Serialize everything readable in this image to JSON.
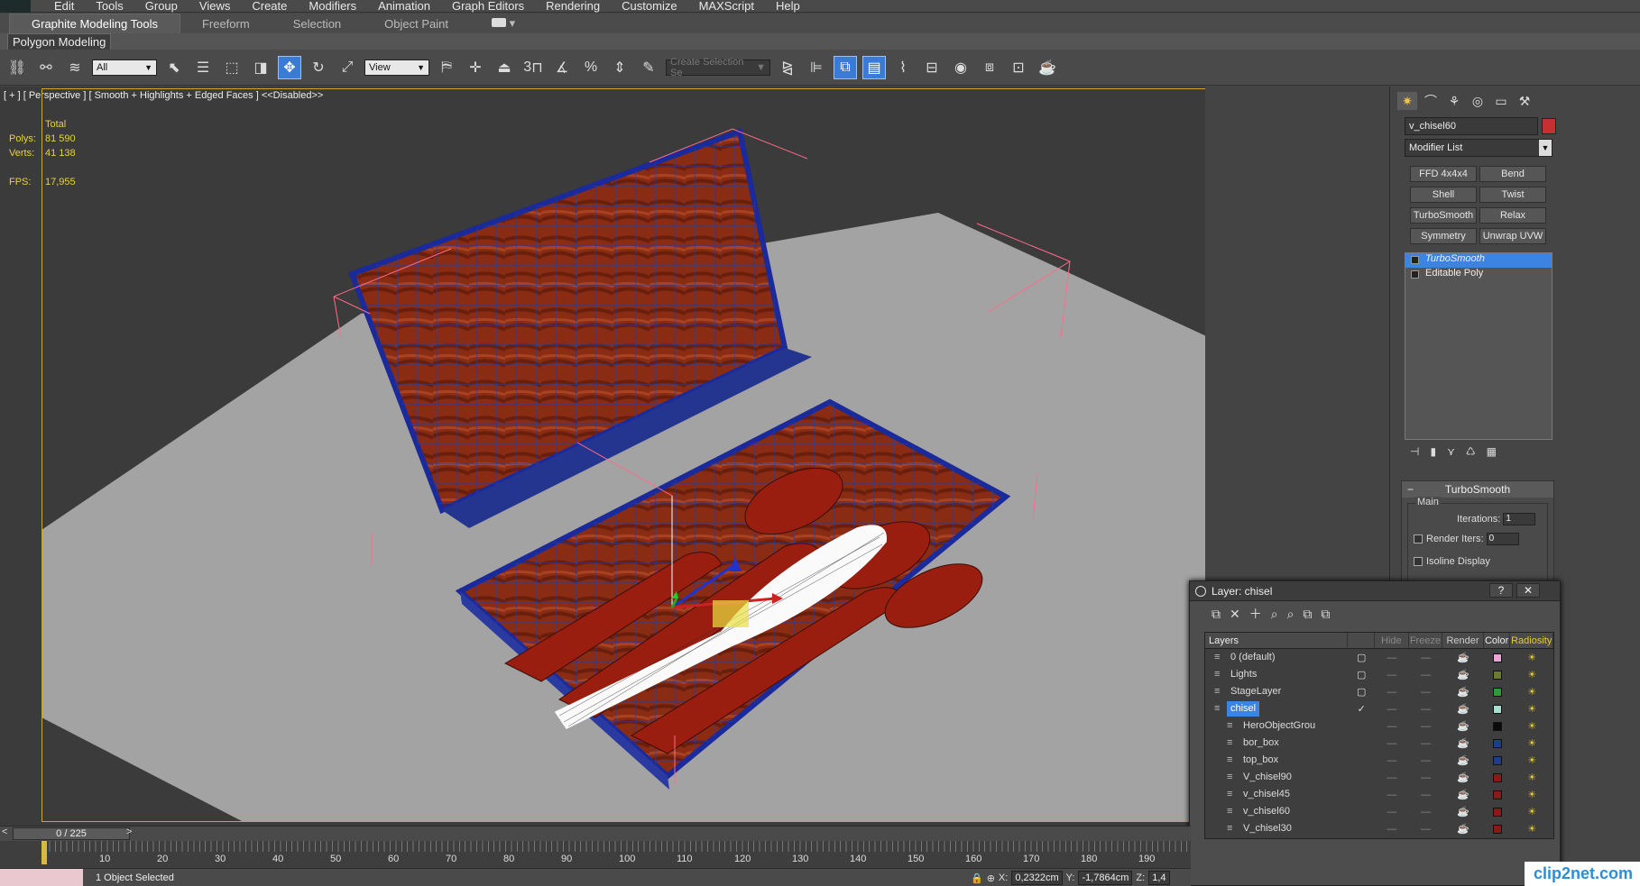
{
  "menu": [
    "Edit",
    "Tools",
    "Group",
    "Views",
    "Create",
    "Modifiers",
    "Animation",
    "Graph Editors",
    "Rendering",
    "Customize",
    "MAXScript",
    "Help"
  ],
  "ribbon": {
    "tabs": [
      "Graphite Modeling Tools",
      "Freeform",
      "Selection",
      "Object Paint"
    ],
    "panel_label": "Polygon Modeling"
  },
  "toolbar": {
    "filter_dropdown": "All",
    "refcoord_dropdown": "View",
    "named_selection_placeholder": "Create Selection Se",
    "snap_labels": [
      "3",
      "%"
    ]
  },
  "viewport": {
    "label": "[ + ] [ Perspective ] [ Smooth + Highlights + Edged Faces ] <<Disabled>>",
    "stats": {
      "total_label": "Total",
      "polys_label": "Polys:",
      "polys_value": "81 590",
      "verts_label": "Verts:",
      "verts_value": "41 138",
      "fps_label": "FPS:",
      "fps_value": "17,955"
    }
  },
  "command_panel": {
    "object_name": "v_chisel60",
    "modifier_list": "Modifier List",
    "modifier_buttons": [
      "FFD 4x4x4",
      "Bend",
      "Shell",
      "Twist",
      "TurboSmooth",
      "Relax",
      "Symmetry",
      "Unwrap UVW"
    ],
    "stack": [
      "TurboSmooth",
      "Editable Poly"
    ],
    "rollout": {
      "title": "TurboSmooth",
      "group": "Main",
      "iterations_label": "Iterations:",
      "iterations_value": "1",
      "render_iters_label": "Render Iters:",
      "render_iters_value": "0",
      "isoline_label": "Isoline Display"
    }
  },
  "layer_dialog": {
    "title": "Layer: chisel",
    "columns": [
      "Layers",
      "Hide",
      "Freeze",
      "Render",
      "Color",
      "Radiosity"
    ],
    "rows": [
      {
        "name": "0 (default)",
        "color": "#e8a6d8",
        "indent": 0,
        "current": false
      },
      {
        "name": "Lights",
        "color": "#6b7a2e",
        "indent": 0,
        "current": false
      },
      {
        "name": "StageLayer",
        "color": "#2e9a3a",
        "indent": 0,
        "current": false
      },
      {
        "name": "chisel",
        "color": "#a8e0d0",
        "indent": 0,
        "current": true
      },
      {
        "name": "HeroObjectGrou",
        "color": "#0a0a0a",
        "indent": 1,
        "current": false
      },
      {
        "name": "bor_box",
        "color": "#1e3e8a",
        "indent": 1,
        "current": false
      },
      {
        "name": "top_box",
        "color": "#1e3e8a",
        "indent": 1,
        "current": false
      },
      {
        "name": "V_chisel90",
        "color": "#8a1a1a",
        "indent": 1,
        "current": false
      },
      {
        "name": "v_chisel45",
        "color": "#8a1a1a",
        "indent": 1,
        "current": false
      },
      {
        "name": "v_chisel60",
        "color": "#8a1a1a",
        "indent": 1,
        "current": false
      },
      {
        "name": "V_chisel30",
        "color": "#8a1a1a",
        "indent": 1,
        "current": false
      }
    ]
  },
  "timeline": {
    "frame_counter": "0 / 225",
    "ticks": [
      "10",
      "20",
      "30",
      "40",
      "50",
      "60",
      "70",
      "80",
      "90",
      "100",
      "110",
      "120",
      "130",
      "140",
      "150",
      "160",
      "170",
      "180",
      "190"
    ]
  },
  "status": {
    "message": "1 Object Selected",
    "x_label": "X:",
    "x_value": "0,2322cm",
    "y_label": "Y:",
    "y_value": "-1,7864cm",
    "z_label": "Z:",
    "z_value": "1,4"
  },
  "watermark": "clip2net.com",
  "colors": {
    "selection_blue": "#3d83e2",
    "frame_yellow": "#c9a92c",
    "object_red": "#c63030"
  }
}
